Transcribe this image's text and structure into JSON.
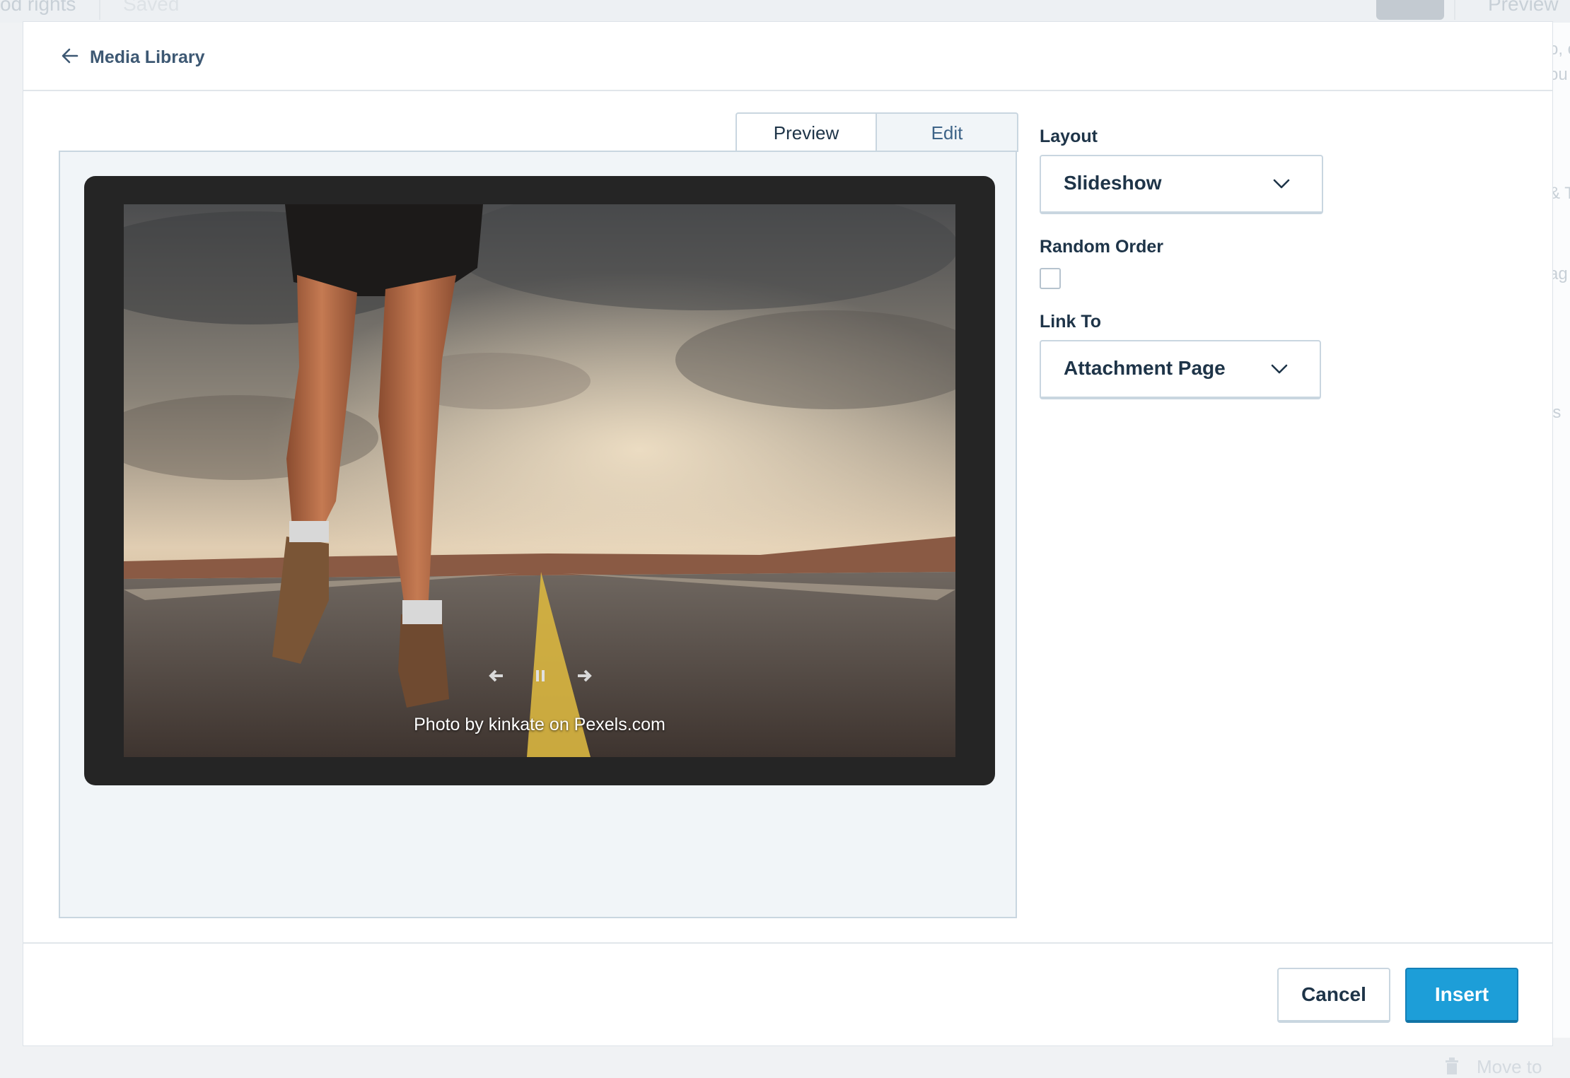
{
  "background": {
    "left_text": "od rights",
    "status_text": "Saved",
    "preview_text": "Preview",
    "side_fragments": [
      "o, c",
      "ou",
      "& T",
      "ag",
      "is"
    ],
    "footer_text": "Move to"
  },
  "header": {
    "back_label": "Media Library"
  },
  "tabs": [
    {
      "label": "Preview",
      "active": true
    },
    {
      "label": "Edit",
      "active": false
    }
  ],
  "preview": {
    "caption": "Photo by kinkate on Pexels.com",
    "controls": [
      "previous-icon",
      "pause-icon",
      "next-icon"
    ]
  },
  "settings": {
    "layout_label": "Layout",
    "layout_value": "Slideshow",
    "random_order_label": "Random Order",
    "random_order_checked": false,
    "link_to_label": "Link To",
    "link_to_value": "Attachment Page"
  },
  "footer": {
    "cancel_label": "Cancel",
    "insert_label": "Insert"
  },
  "colors": {
    "accent": "#1d9ed8",
    "text": "#1e3448",
    "link": "#3d5873",
    "border": "#c9d6e0",
    "pane": "#f1f5f8",
    "frame": "#252525"
  }
}
